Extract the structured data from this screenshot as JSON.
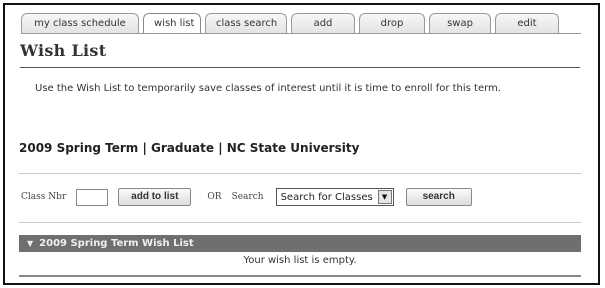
{
  "tabs": [
    {
      "label": "my class schedule",
      "active": false
    },
    {
      "label": "wish list",
      "active": true
    },
    {
      "label": "class search",
      "active": false
    },
    {
      "label": "add",
      "active": false
    },
    {
      "label": "drop",
      "active": false
    },
    {
      "label": "swap",
      "active": false
    },
    {
      "label": "edit",
      "active": false
    }
  ],
  "page": {
    "title": "Wish List",
    "intro": "Use the Wish List to temporarily save classes of interest until it is time to enroll for this term.",
    "term": "2009 Spring Term | Graduate | NC State University"
  },
  "search_bar": {
    "class_nbr_label": "Class Nbr",
    "class_nbr_value": "",
    "add_button": "add to list",
    "or_label": "OR",
    "search_label": "Search",
    "select_value": "Search for Classes",
    "search_button": "search"
  },
  "wishlist_panel": {
    "header": "2009 Spring Term Wish List",
    "empty_message": "Your wish list is empty."
  },
  "colors": {
    "panel_header_bg": "#6f6f6f",
    "frame_border": "#111111"
  }
}
